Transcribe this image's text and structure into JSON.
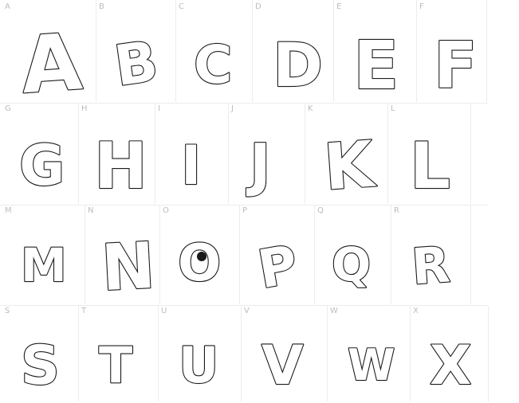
{
  "rows": [
    {
      "cells": [
        {
          "label": "A",
          "glyph": "A"
        },
        {
          "label": "B",
          "glyph": "B"
        },
        {
          "label": "C",
          "glyph": "C"
        },
        {
          "label": "D",
          "glyph": "D"
        },
        {
          "label": "E",
          "glyph": "E"
        },
        {
          "label": "F",
          "glyph": "F"
        }
      ]
    },
    {
      "cells": [
        {
          "label": "G",
          "glyph": "G"
        },
        {
          "label": "H",
          "glyph": "H"
        },
        {
          "label": "I",
          "glyph": "I"
        },
        {
          "label": "J",
          "glyph": "J"
        },
        {
          "label": "K",
          "glyph": "K"
        },
        {
          "label": "L",
          "glyph": "L"
        }
      ]
    },
    {
      "cells": [
        {
          "label": "M",
          "glyph": "M"
        },
        {
          "label": "N",
          "glyph": "N"
        },
        {
          "label": "O",
          "glyph": "O"
        },
        {
          "label": "P",
          "glyph": "P"
        },
        {
          "label": "Q",
          "glyph": "Q"
        },
        {
          "label": "R",
          "glyph": "R"
        }
      ]
    },
    {
      "cells": [
        {
          "label": "S",
          "glyph": "S"
        },
        {
          "label": "T",
          "glyph": "T"
        },
        {
          "label": "U",
          "glyph": "U"
        },
        {
          "label": "V",
          "glyph": "V"
        },
        {
          "label": "W",
          "glyph": "W"
        },
        {
          "label": "X",
          "glyph": "X"
        }
      ]
    }
  ]
}
